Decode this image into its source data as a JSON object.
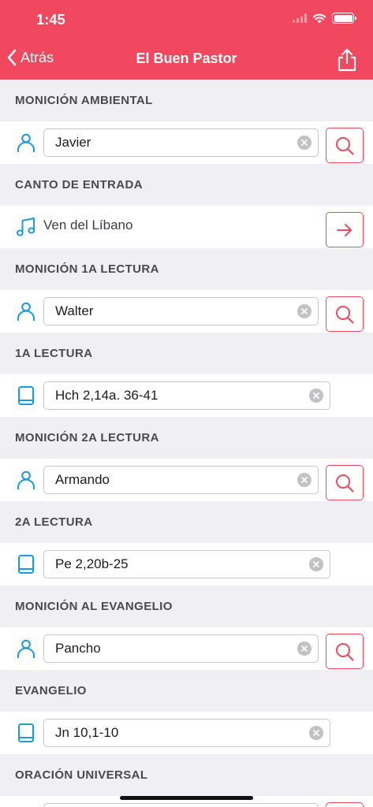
{
  "status_bar": {
    "time": "1:45"
  },
  "nav": {
    "back_label": "Atrás",
    "title": "El Buen Pastor"
  },
  "colors": {
    "accent": "#f2485f",
    "icon_blue": "#1a9bdb",
    "section_bg": "#efeff4"
  },
  "sections": [
    {
      "title": "MONICIÓN AMBIENTAL",
      "row_type": "person",
      "value": "Javier",
      "icon": "person-icon",
      "action": "search-icon"
    },
    {
      "title": "CANTO DE ENTRADA",
      "row_type": "song",
      "value": "Ven del Líbano",
      "icon": "music-note-icon",
      "action": "arrow-right-icon"
    },
    {
      "title": "MONICIÓN 1A LECTURA",
      "row_type": "person",
      "value": "Walter",
      "icon": "person-icon",
      "action": "search-icon"
    },
    {
      "title": "1A LECTURA",
      "row_type": "reading",
      "value": "Hch 2,14a. 36-41",
      "icon": "book-icon"
    },
    {
      "title": "MONICIÓN 2A LECTURA",
      "row_type": "person",
      "value": "Armando",
      "icon": "person-icon",
      "action": "search-icon"
    },
    {
      "title": "2A LECTURA",
      "row_type": "reading",
      "value": "Pe 2,20b-25",
      "icon": "book-icon"
    },
    {
      "title": "MONICIÓN AL EVANGELIO",
      "row_type": "person",
      "value": "Pancho",
      "icon": "person-icon",
      "action": "search-icon"
    },
    {
      "title": "EVANGELIO",
      "row_type": "reading",
      "value": "Jn 10,1-10",
      "icon": "book-icon"
    },
    {
      "title": "ORACIÓN UNIVERSAL",
      "row_type": "person",
      "value": "",
      "icon": "person-icon",
      "action": "search-icon"
    }
  ]
}
